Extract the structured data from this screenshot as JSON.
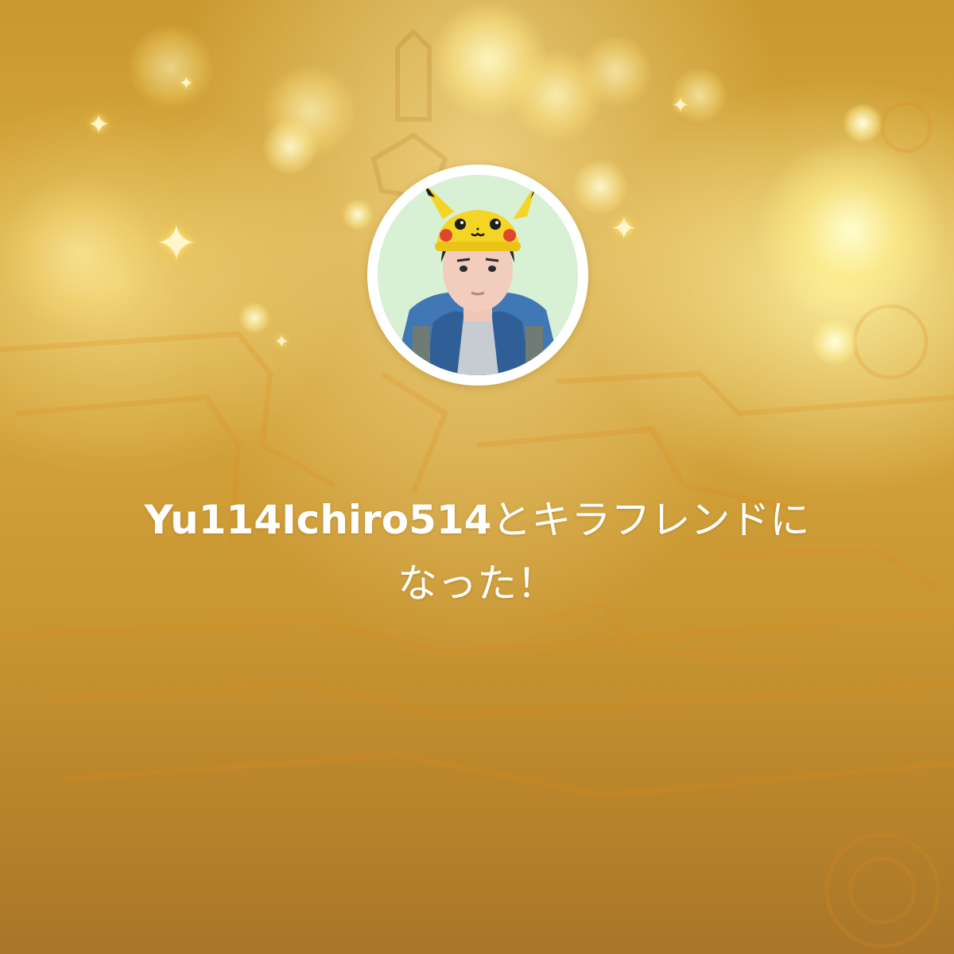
{
  "friendship": {
    "username": "Yu114Ichiro514",
    "message_suffix": "とキラフレンドに",
    "message_line2": "なった！"
  },
  "avatar": {
    "icon": "trainer-avatar-pikachu-hat"
  },
  "colors": {
    "background_gold": "#d2a23a",
    "text": "#ffffff",
    "avatar_ring": "#ffffff",
    "avatar_bg": "#d9f0d4"
  }
}
